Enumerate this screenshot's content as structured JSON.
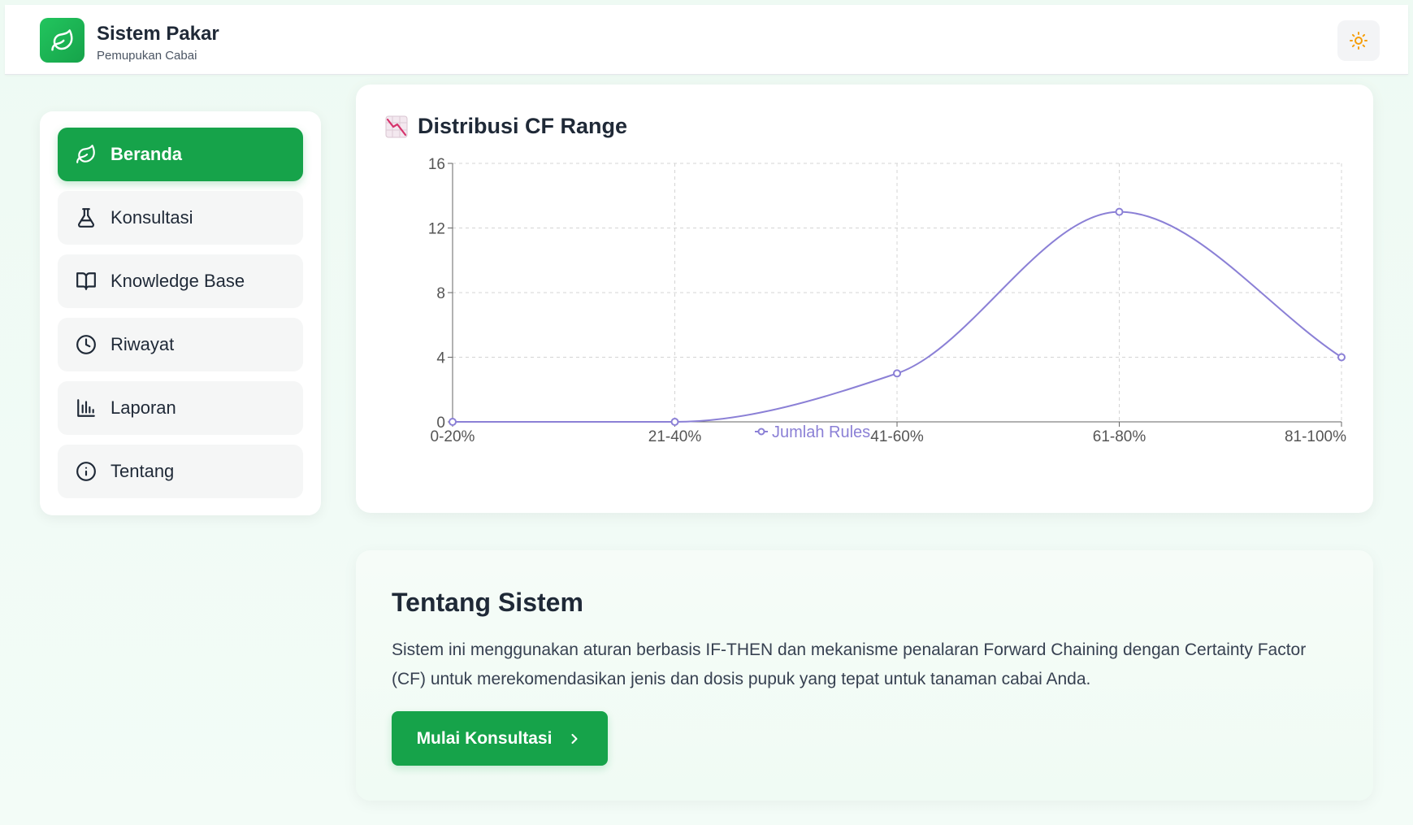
{
  "header": {
    "title": "Sistem Pakar",
    "subtitle": "Pemupukan Cabai",
    "logo_icon": "leaf-icon",
    "theme_toggle_icon": "sun-icon"
  },
  "sidebar": {
    "items": [
      {
        "label": "Beranda",
        "icon": "leaf-icon",
        "active": true
      },
      {
        "label": "Konsultasi",
        "icon": "flask-icon",
        "active": false
      },
      {
        "label": "Knowledge Base",
        "icon": "book-open-icon",
        "active": false
      },
      {
        "label": "Riwayat",
        "icon": "clock-icon",
        "active": false
      },
      {
        "label": "Laporan",
        "icon": "bar-chart-icon",
        "active": false
      },
      {
        "label": "Tentang",
        "icon": "info-icon",
        "active": false
      }
    ]
  },
  "chart_card": {
    "title": "Distribusi CF Range",
    "title_icon": "chart-decreasing-icon"
  },
  "chart_data": {
    "type": "line",
    "title": "Distribusi CF Range",
    "categories": [
      "0-20%",
      "21-40%",
      "41-60%",
      "61-80%",
      "81-100%"
    ],
    "series": [
      {
        "name": "Jumlah Rules",
        "values": [
          0,
          0,
          3,
          13,
          4
        ],
        "color": "#8b80d6"
      }
    ],
    "ylim": [
      0,
      16
    ],
    "yticks": [
      0,
      4,
      8,
      12,
      16
    ],
    "grid": true,
    "legend": "bottom",
    "smooth": true
  },
  "about": {
    "title": "Tentang Sistem",
    "text": "Sistem ini menggunakan aturan berbasis IF-THEN dan mekanisme penalaran Forward Chaining dengan Certainty Factor (CF) untuk merekomendasikan jenis dan dosis pupuk yang tepat untuk tanaman cabai Anda.",
    "cta_label": "Mulai Konsultasi"
  },
  "colors": {
    "primary": "#16a34a",
    "line": "#8b80d6"
  }
}
